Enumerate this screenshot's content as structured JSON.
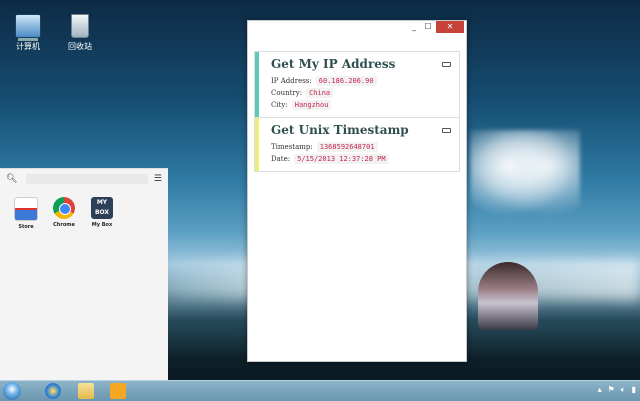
{
  "desktop": {
    "icons": [
      {
        "label": "计算机"
      },
      {
        "label": "回收站"
      }
    ]
  },
  "launcher": {
    "apps": [
      {
        "label": "Store"
      },
      {
        "label": "Chrome"
      },
      {
        "label": "My Box",
        "icon_text": "MY BOX"
      }
    ]
  },
  "window": {
    "cards": [
      {
        "title": "Get My IP Address",
        "accent": "#5cc9b8",
        "rows": [
          {
            "key": "IP Address:",
            "value": "60.186.206.90"
          },
          {
            "key": "Country:",
            "value": "China"
          },
          {
            "key": "City:",
            "value": "Hangzhou"
          }
        ]
      },
      {
        "title": "Get Unix Timestamp",
        "accent": "#e9ef7a",
        "rows": [
          {
            "key": "Timestamp:",
            "value": "1368592648701"
          },
          {
            "key": "Date:",
            "value": "5/15/2013 12:37:28 PM"
          }
        ]
      }
    ],
    "buttons": {
      "minimize": "_",
      "maximize": "☐",
      "close": "✕"
    }
  }
}
